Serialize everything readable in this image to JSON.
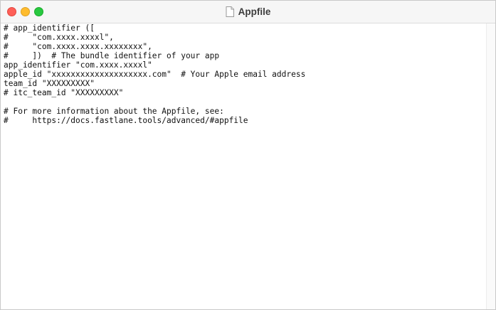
{
  "window": {
    "title": "Appfile",
    "title_icon": "document-icon"
  },
  "editor": {
    "lines": [
      "# app_identifier ([",
      "#     \"com.xxxx.xxxxl\",",
      "#     \"com.xxxx.xxxx.xxxxxxxx\",",
      "#     ])  # The bundle identifier of your app",
      "app_identifier \"com.xxxx.xxxxl\"",
      "apple_id \"xxxxxxxxxxxxxxxxxxxx.com\"  # Your Apple email address",
      "team_id \"XXXXXXXXX\"",
      "# itc_team_id \"XXXXXXXXX\"",
      "",
      "# For more information about the Appfile, see:",
      "#     https://docs.fastlane.tools/advanced/#appfile"
    ]
  },
  "colors": {
    "close": "#fe5f57",
    "minimize": "#febc2e",
    "zoom": "#28c840"
  }
}
